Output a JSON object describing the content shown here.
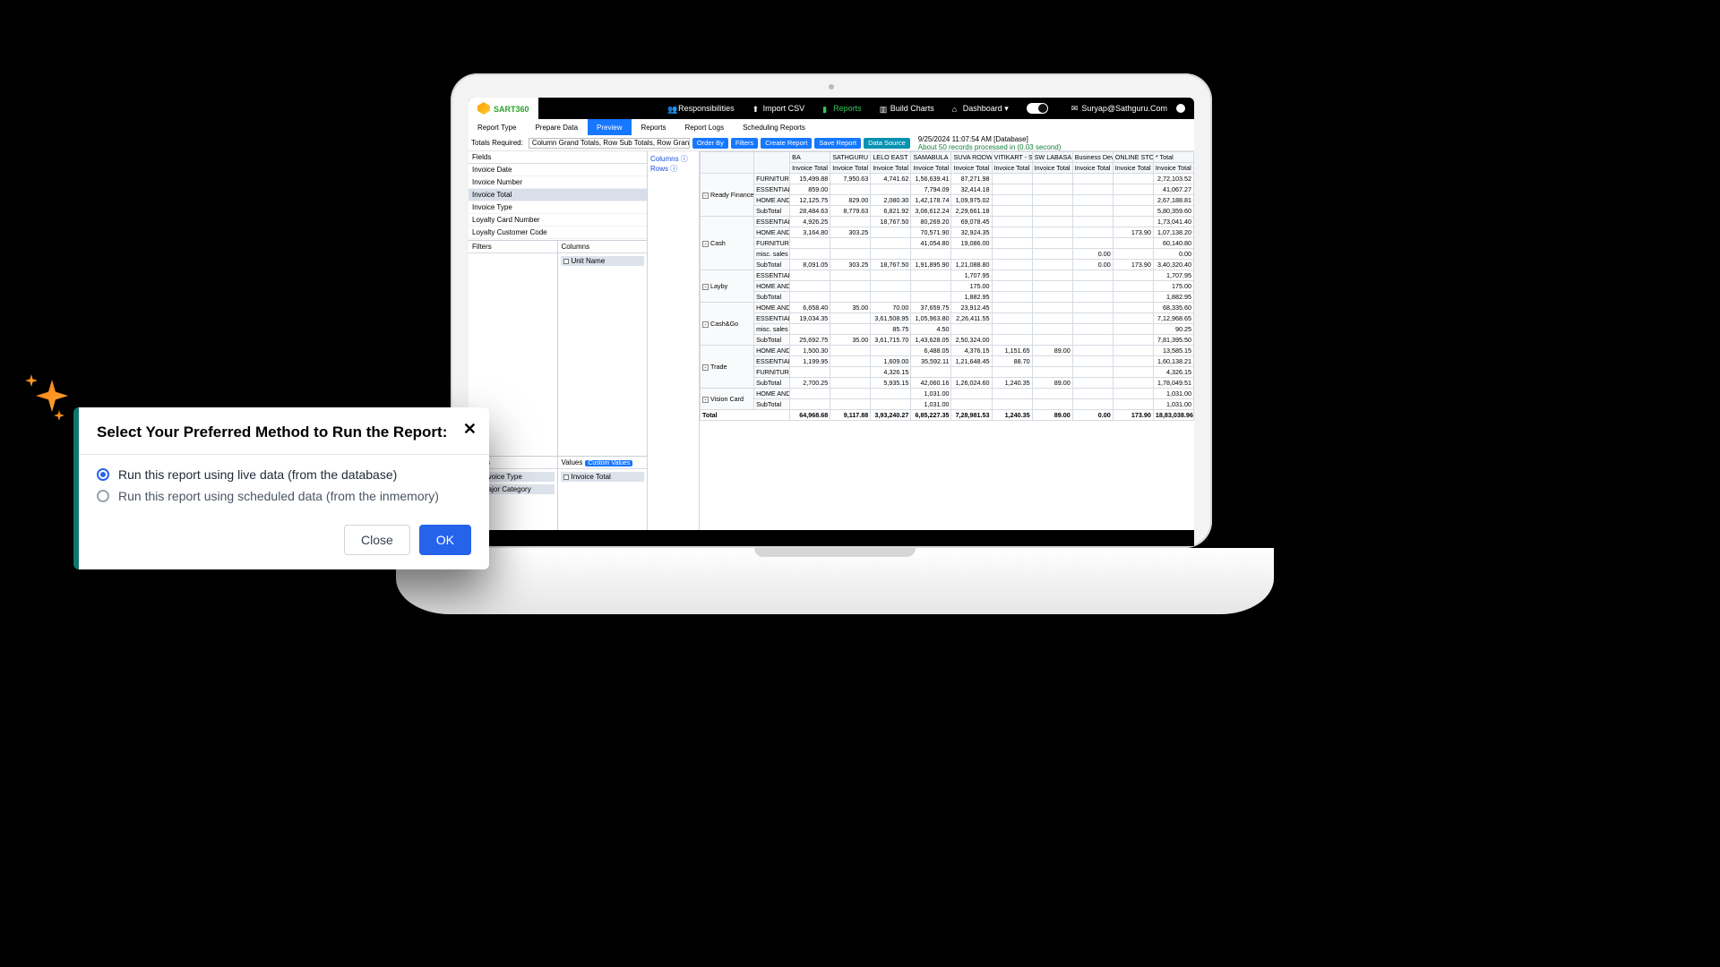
{
  "brand": {
    "name": "SART",
    "suffix": "360"
  },
  "header": {
    "responsibilities": "Responsibilities",
    "import_csv": "Import CSV",
    "reports": "Reports",
    "build_charts": "Build Charts",
    "dashboard": "Dashboard ▾",
    "user": "Suryap@Sathguru.Com"
  },
  "ribbon": {
    "report_type": "Report Type",
    "prepare_data": "Prepare Data",
    "preview": "Preview",
    "reports": "Reports",
    "report_logs": "Report Logs",
    "scheduling": "Scheduling Reports"
  },
  "toolbar": {
    "totals_label": "Totals Required:",
    "totals_value": "Column Grand Totals, Row Sub Totals, Row Grand Tot…",
    "order_by": "Order By",
    "filters": "Filters",
    "create_report": "Create Report",
    "save_report": "Save Report",
    "data_source": "Data Source",
    "status_time": "9/25/2024 11:07:54 AM  [Database]",
    "status_records": "About 50 records processed in (0.03 second)"
  },
  "panes": {
    "fields_hdr": "Fields",
    "fields": [
      "Invoice Date",
      "Invoice Number",
      "Invoice Total",
      "Invoice Type",
      "Loyalty Card Number",
      "Loyalty Customer Code"
    ],
    "filters_hdr": "Filters",
    "columns_hdr": "Columns",
    "columns_chip": "Unit Name",
    "rows_hdr": "Rows",
    "rows_chips": [
      "Invoice Type",
      "Major Category"
    ],
    "values_hdr": "Values",
    "values_badge": "Custom Values",
    "values_chip": "Invoice Total"
  },
  "midstrip": {
    "columns": "Columns",
    "rows": "Rows",
    "info": "ⓘ"
  },
  "grid": {
    "top_headers": [
      "BA",
      "SATHGURU TAILE",
      "LELO EAST",
      "SAMABULA",
      "SUVA RODWELL",
      "VITIKART - SATH",
      "SW LABASA",
      "Business Devel",
      "ONLINE STORE",
      "* Total"
    ],
    "sub_header": "Invoice Total",
    "groups": [
      {
        "name": "Ready Finance",
        "rows": [
          {
            "cat": "FURNITURE",
            "v": [
              "15,499.88",
              "7,950.63",
              "4,741.62",
              "1,56,639.41",
              "87,271.98",
              "",
              "",
              "",
              "",
              "2,72,103.52"
            ]
          },
          {
            "cat": "ESSENTIALS",
            "v": [
              "859.00",
              "",
              "",
              "7,794.09",
              "32,414.18",
              "",
              "",
              "",
              "",
              "41,067.27"
            ]
          },
          {
            "cat": "HOME AND",
            "v": [
              "12,125.75",
              "829.00",
              "2,080.30",
              "1,42,178.74",
              "1,09,975.02",
              "",
              "",
              "",
              "",
              "2,67,188.81"
            ]
          },
          {
            "cat": "SubTotal",
            "v": [
              "28,484.63",
              "8,779.63",
              "6,821.92",
              "3,06,612.24",
              "2,29,661.18",
              "",
              "",
              "",
              "",
              "5,80,359.60"
            ],
            "sub": true
          }
        ]
      },
      {
        "name": "Cash",
        "rows": [
          {
            "cat": "ESSENTIALS",
            "v": [
              "4,926.25",
              "",
              "18,767.50",
              "80,269.20",
              "69,078.45",
              "",
              "",
              "",
              "",
              "1,73,041.40"
            ]
          },
          {
            "cat": "HOME AND",
            "v": [
              "3,164.80",
              "303.25",
              "",
              "70,571.90",
              "32,924.35",
              "",
              "",
              "",
              "173.90",
              "1,07,138.20"
            ]
          },
          {
            "cat": "FURNITURE",
            "v": [
              "",
              "",
              "",
              "41,054.80",
              "19,086.00",
              "",
              "",
              "",
              "",
              "60,140.80"
            ]
          },
          {
            "cat": "misc. sales",
            "v": [
              "",
              "",
              "",
              "",
              "",
              "",
              "",
              "0.00",
              "",
              "0.00"
            ]
          },
          {
            "cat": "SubTotal",
            "v": [
              "8,091.05",
              "303.25",
              "18,767.50",
              "1,91,895.90",
              "1,21,088.80",
              "",
              "",
              "0.00",
              "173.90",
              "3,40,320.40"
            ],
            "sub": true
          }
        ]
      },
      {
        "name": "Layby",
        "rows": [
          {
            "cat": "ESSENTIALS",
            "v": [
              "",
              "",
              "",
              "",
              "1,707.95",
              "",
              "",
              "",
              "",
              "1,707.95"
            ]
          },
          {
            "cat": "HOME AND",
            "v": [
              "",
              "",
              "",
              "",
              "175.00",
              "",
              "",
              "",
              "",
              "175.00"
            ]
          },
          {
            "cat": "SubTotal",
            "v": [
              "",
              "",
              "",
              "",
              "1,882.95",
              "",
              "",
              "",
              "",
              "1,882.95"
            ],
            "sub": true
          }
        ]
      },
      {
        "name": "Cash&Go",
        "rows": [
          {
            "cat": "HOME AND",
            "v": [
              "6,658.40",
              "35.00",
              "70.00",
              "37,659.75",
              "23,912.45",
              "",
              "",
              "",
              "",
              "68,335.60"
            ]
          },
          {
            "cat": "ESSENTIALS",
            "v": [
              "19,034.35",
              "",
              "3,61,508.95",
              "1,05,963.80",
              "2,26,411.55",
              "",
              "",
              "",
              "",
              "7,12,968.65"
            ]
          },
          {
            "cat": "misc. sales",
            "v": [
              "",
              "",
              "85.75",
              "4.50",
              "",
              "",
              "",
              "",
              "",
              "90.25"
            ]
          },
          {
            "cat": "SubTotal",
            "v": [
              "25,692.75",
              "35.00",
              "3,61,715.70",
              "1,43,628.05",
              "2,50,324.00",
              "",
              "",
              "",
              "",
              "7,81,395.50"
            ],
            "sub": true
          }
        ]
      },
      {
        "name": "Trade",
        "rows": [
          {
            "cat": "HOME AND",
            "v": [
              "1,500.30",
              "",
              "",
              "6,488.05",
              "4,376.15",
              "1,151.65",
              "89.00",
              "",
              "",
              "13,585.15"
            ]
          },
          {
            "cat": "ESSENTIALS",
            "v": [
              "1,199.95",
              "",
              "1,609.00",
              "35,592.11",
              "1,21,648.45",
              "88.70",
              "",
              "",
              "",
              "1,60,138.21"
            ]
          },
          {
            "cat": "FURNITURE",
            "v": [
              "",
              "",
              "4,326.15",
              "",
              "",
              "",
              "",
              "",
              "",
              "4,326.15"
            ]
          },
          {
            "cat": "SubTotal",
            "v": [
              "2,700.25",
              "",
              "5,935.15",
              "42,060.16",
              "1,26,024.60",
              "1,240.35",
              "89.00",
              "",
              "",
              "1,78,049.51"
            ],
            "sub": true
          }
        ]
      },
      {
        "name": "Vision Card",
        "rows": [
          {
            "cat": "HOME AND",
            "v": [
              "",
              "",
              "",
              "1,031.00",
              "",
              "",
              "",
              "",
              "",
              "1,031.00"
            ]
          },
          {
            "cat": "SubTotal",
            "v": [
              "",
              "",
              "",
              "1,031.00",
              "",
              "",
              "",
              "",
              "",
              "1,031.00"
            ],
            "sub": true
          }
        ]
      }
    ],
    "total_row": {
      "label": "Total",
      "v": [
        "64,968.68",
        "9,117.88",
        "3,93,240.27",
        "6,85,227.35",
        "7,28,981.53",
        "1,240.35",
        "89.00",
        "0.00",
        "173.90",
        "18,83,038.96"
      ]
    }
  },
  "modal": {
    "title": "Select Your Preferred Method to Run the Report:",
    "opt_live": "Run this report using live data (from the database)",
    "opt_mem": "Run this report using scheduled data (from the inmemory)",
    "close": "Close",
    "ok": "OK"
  }
}
